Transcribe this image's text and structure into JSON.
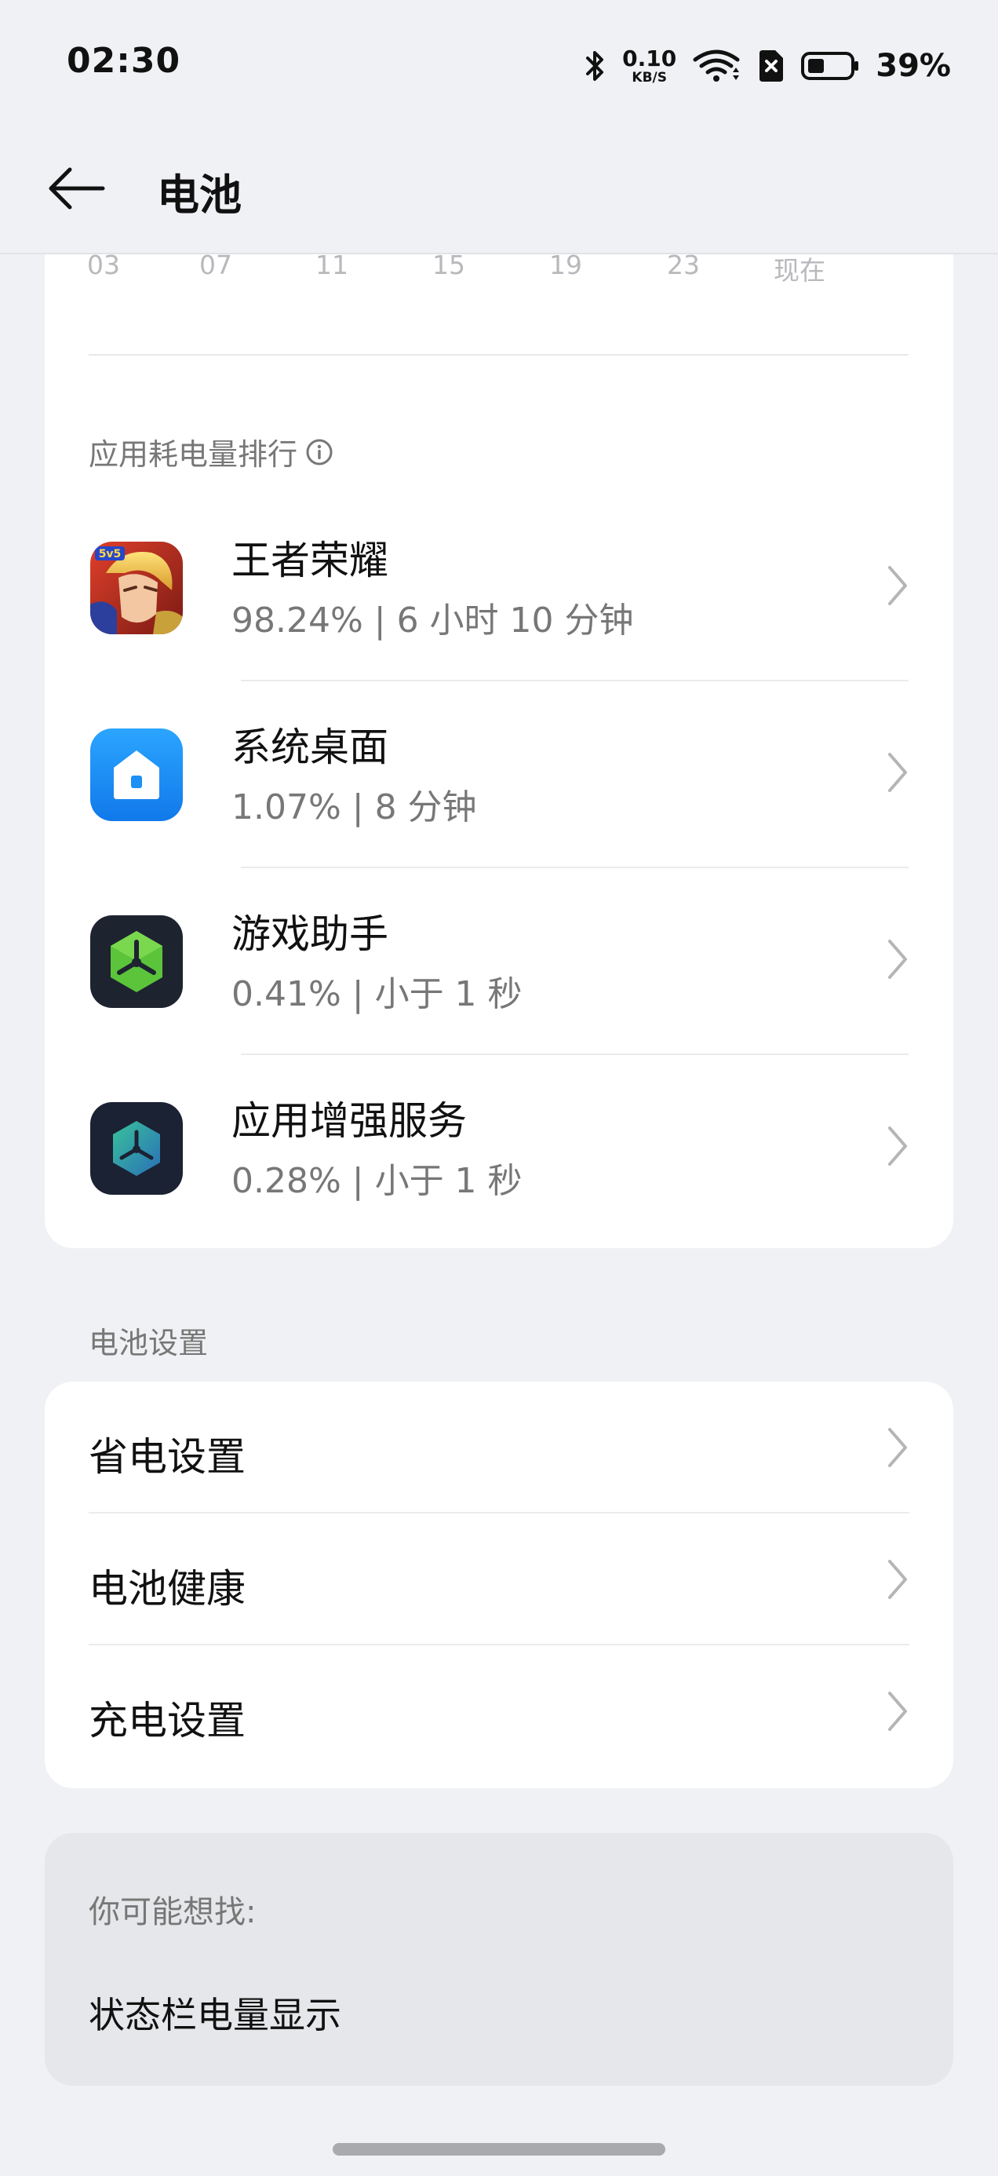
{
  "status_bar": {
    "time": "02:30",
    "net_speed_value": "0.10",
    "net_speed_unit": "KB/S",
    "battery_percent": "39%",
    "icons": [
      "bluetooth-icon",
      "wifi-icon",
      "sim-off-icon",
      "battery-icon"
    ]
  },
  "header": {
    "title": "电池",
    "back_icon": "back-arrow-icon"
  },
  "usage_chart": {
    "x_labels": [
      "03",
      "07",
      "11",
      "15",
      "19",
      "23",
      "现在"
    ]
  },
  "app_ranking": {
    "title": "应用耗电量排行",
    "apps": [
      {
        "name": "王者荣耀",
        "stats": "98.24% | 6 小时 10 分钟",
        "icon": "game-king-glory-icon"
      },
      {
        "name": "系统桌面",
        "stats": "1.07% | 8 分钟",
        "icon": "launcher-icon"
      },
      {
        "name": "游戏助手",
        "stats": "0.41% | 小于 1 秒",
        "icon": "game-assistant-icon"
      },
      {
        "name": "应用增强服务",
        "stats": "0.28% | 小于 1 秒",
        "icon": "app-enhance-icon"
      }
    ]
  },
  "battery_settings": {
    "title": "电池设置",
    "items": [
      {
        "label": "省电设置"
      },
      {
        "label": "电池健康"
      },
      {
        "label": "充电设置"
      }
    ]
  },
  "suggestions": {
    "title": "你可能想找:",
    "items": [
      {
        "label": "状态栏电量显示"
      }
    ]
  },
  "colors": {
    "background": "#f0f1f4",
    "card": "#ffffff",
    "launcher_blue": "#1d8ff5",
    "assistant_green": "#5bc43a"
  }
}
